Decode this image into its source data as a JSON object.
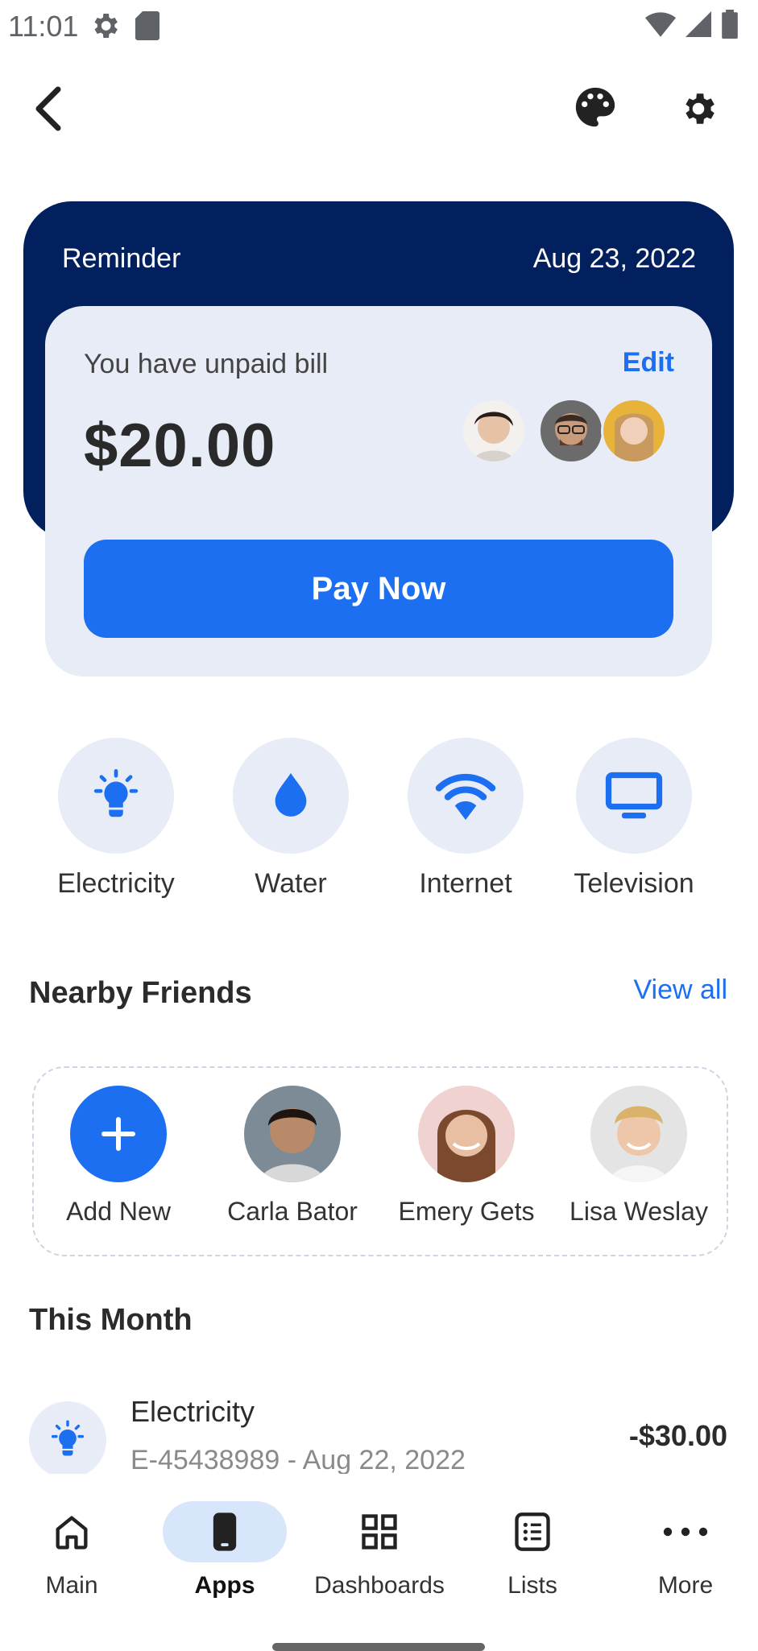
{
  "status_bar": {
    "time": "11:01"
  },
  "reminder": {
    "label": "Reminder",
    "date": "Aug 23, 2022",
    "message": "You have unpaid bill",
    "edit_label": "Edit",
    "amount": "$20.00",
    "pay_label": "Pay Now"
  },
  "categories": [
    {
      "label": "Electricity",
      "icon": "lightbulb-icon"
    },
    {
      "label": "Water",
      "icon": "water-drop-icon"
    },
    {
      "label": "Internet",
      "icon": "wifi-icon"
    },
    {
      "label": "Television",
      "icon": "television-icon"
    }
  ],
  "nearby": {
    "title": "Nearby Friends",
    "view_all": "View all",
    "friends": [
      {
        "name": "Add New",
        "icon": "plus-icon"
      },
      {
        "name": "Carla Bator"
      },
      {
        "name": "Emery Gets"
      },
      {
        "name": "Lisa Weslay"
      }
    ]
  },
  "this_month": {
    "title": "This Month",
    "transactions": [
      {
        "title": "Electricity",
        "subtitle": "E-45438989 - Aug 22, 2022",
        "amount": "-$30.00",
        "icon": "lightbulb-icon"
      }
    ]
  },
  "nav": {
    "items": [
      {
        "label": "Main",
        "icon": "home-icon"
      },
      {
        "label": "Apps",
        "icon": "phone-icon",
        "active": true
      },
      {
        "label": "Dashboards",
        "icon": "dashboard-icon"
      },
      {
        "label": "Lists",
        "icon": "list-icon"
      },
      {
        "label": "More",
        "icon": "more-icon"
      }
    ]
  },
  "colors": {
    "primary": "#1b6ff0",
    "navy": "#01205d",
    "card_bg": "#e7ecf6"
  }
}
